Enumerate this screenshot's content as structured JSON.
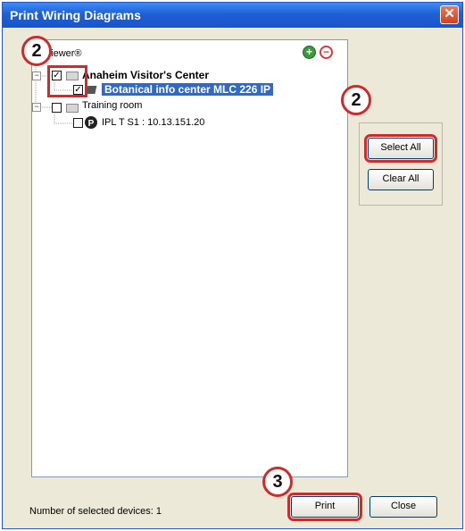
{
  "window": {
    "title": "Print Wiring Diagrams",
    "close_glyph": "✕"
  },
  "tree": {
    "header": "Viewer®",
    "nodes": [
      {
        "label": "Anaheim Visitor's Center",
        "checked": true,
        "type": "folder"
      },
      {
        "label": "Botanical info center MLC 226 IP",
        "checked": true,
        "type": "device",
        "selected": true
      },
      {
        "label": "Training room",
        "checked": false,
        "type": "folder"
      },
      {
        "label": "IPL T S1 : 10.13.151.20",
        "checked": false,
        "type": "device"
      }
    ]
  },
  "buttons": {
    "select_all": "Select All",
    "clear_all": "Clear All",
    "print": "Print",
    "close": "Close"
  },
  "status": {
    "text": "Number of selected devices: 1"
  },
  "callouts": {
    "step_tree": "2",
    "step_select": "2",
    "step_print": "3"
  },
  "colors": {
    "title_bar": "#1f5fd6",
    "callout": "#d02a2a",
    "selection": "#316ac5"
  }
}
